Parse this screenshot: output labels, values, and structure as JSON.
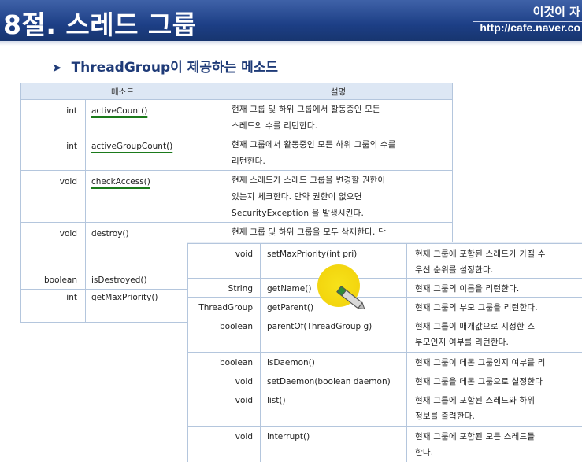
{
  "header": {
    "title": "8절. 스레드 그룹",
    "right_top": "이것이 자",
    "right_bottom": "http://cafe.naver.co"
  },
  "section": {
    "title": "ThreadGroup이 제공하는 메소드"
  },
  "table_back": {
    "headers": [
      "메소드",
      "설명"
    ],
    "rows": [
      {
        "type": "int",
        "method": "activeCount()",
        "desc": [
          "현재  그룹  및  하위  그룹에서  활동중인  모든",
          "스레드의 수를 리턴한다."
        ]
      },
      {
        "type": "int",
        "method": "activeGroupCount()",
        "desc": [
          "현재 그룹에서 활동중인 모든 하위 그룹의 수를",
          "리턴한다."
        ]
      },
      {
        "type": "void",
        "method": "checkAccess()",
        "desc": [
          "현재  스레드가  스레드  그룹을  변경할  권한이",
          "있는지     체크한다.     만약     권한이     없으면",
          "SecurityException 을  발생시킨다."
        ]
      },
      {
        "type": "void",
        "method": "destroy()",
        "desc": [
          "현재  그룹  및  하위  그룹을  모두  삭제한다.  단"
        ]
      },
      {
        "type": "boolean",
        "method": "isDestroyed()",
        "desc": [
          ""
        ]
      },
      {
        "type": "int",
        "method": "getMaxPriority()",
        "desc": [
          ""
        ]
      }
    ]
  },
  "table_front": {
    "rows": [
      {
        "type": "void",
        "method": "setMaxPriority(int pri)",
        "desc": [
          "현재 그룹에 포함된 스레드가 가질 수",
          "우선 순위를 설정한다."
        ]
      },
      {
        "type": "String",
        "method": "getName()",
        "desc": [
          "현재 그룹의 이름을 리턴한다."
        ]
      },
      {
        "type": "ThreadGroup",
        "method": "getParent()",
        "desc": [
          "현재 그룹의 부모 그룹을 리턴한다."
        ]
      },
      {
        "type": "boolean",
        "method": "parentOf(ThreadGroup  g)",
        "desc": [
          "현재  그룹이  매개값으로  지정한  스",
          "부모인지 여부를 리턴한다."
        ]
      },
      {
        "type": "boolean",
        "method": "isDaemon()",
        "desc": [
          "현재 그룹이 데몬 그룹인지 여부를 리"
        ]
      },
      {
        "type": "void",
        "method": "setDaemon(boolean  daemon)",
        "desc": [
          "현재 그룹을 데몬 그룹으로 설정한다"
        ]
      },
      {
        "type": "void",
        "method": "list()",
        "desc": [
          "현재  그룹에  포함된  스레드와  하위",
          "정보를 출력한다."
        ]
      },
      {
        "type": "void",
        "method": "interrupt()",
        "desc": [
          "현재  그룹에  포함된  모든  스레드들",
          "한다."
        ]
      }
    ]
  },
  "colors": {
    "header_bg": "#1d3f86",
    "section_title": "#1f3b78",
    "table_header_bg": "#dde7f4",
    "underline": "#1b7a1b",
    "cursor_highlight": "#f3d60f"
  },
  "icons": {
    "bullet": "arrow-bullet-icon",
    "cursor": "pen-cursor-icon"
  }
}
